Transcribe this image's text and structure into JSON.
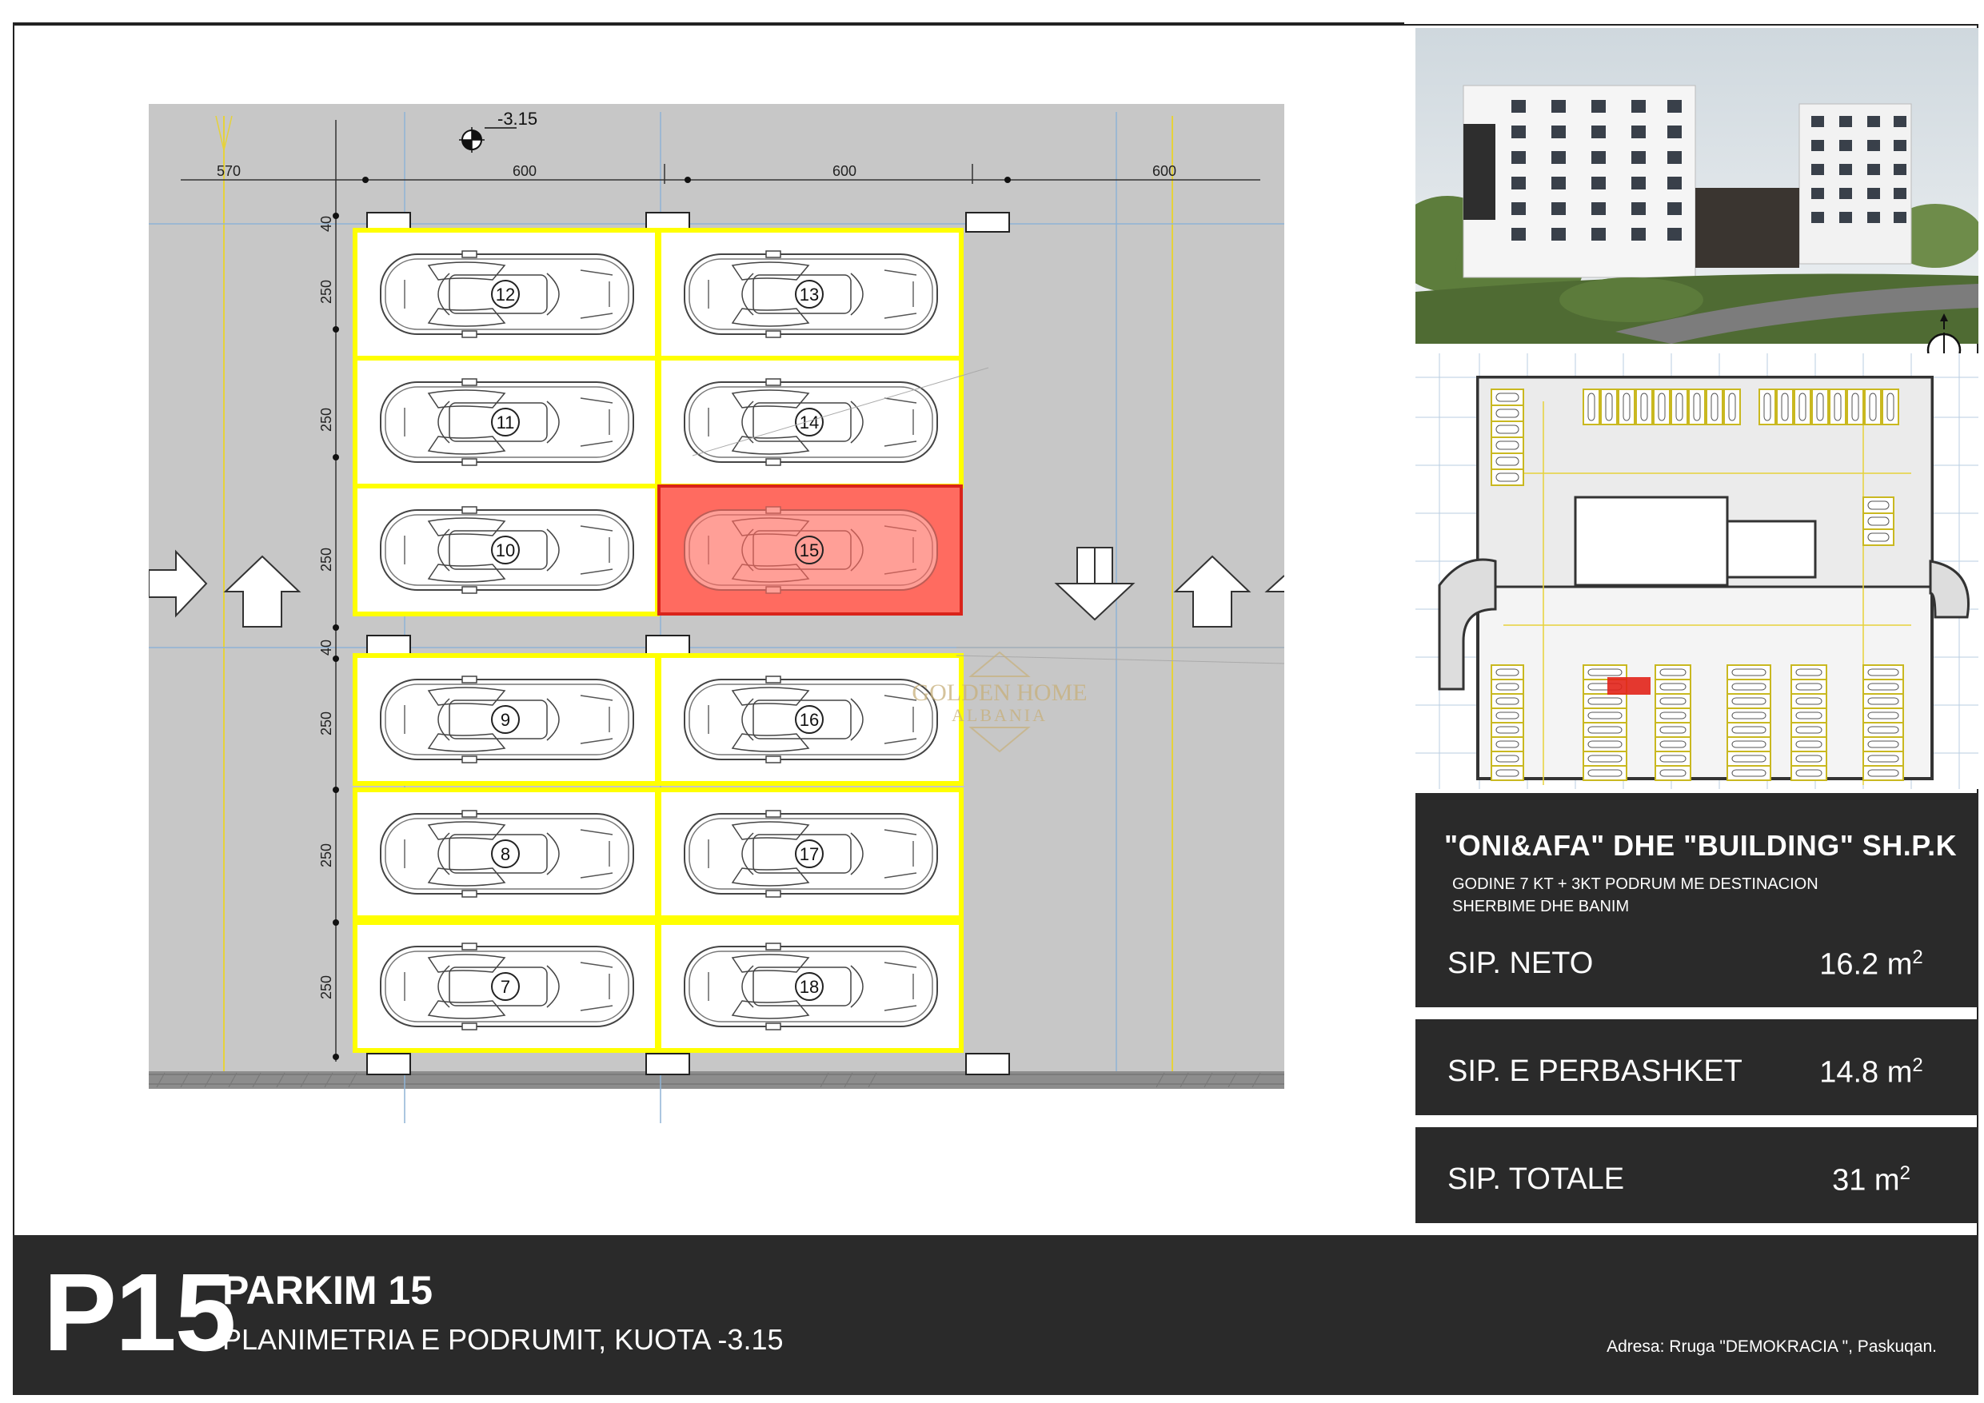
{
  "plan": {
    "level_marker": "-3.15",
    "dimensions_top": [
      "570",
      "600",
      "600",
      "600"
    ],
    "row_dimension": "250",
    "gap_dimension": "40",
    "spots_left": [
      "12",
      "11",
      "10",
      "9",
      "8",
      "7"
    ],
    "spots_right": [
      "13",
      "14",
      "15",
      "16",
      "17",
      "18"
    ],
    "highlighted_spot": "15",
    "highlight_color": "#ff6b60",
    "bay_outline_color": "#ffff00"
  },
  "watermark": {
    "line1": "GOLDEN HOME",
    "line2": "ALBANIA"
  },
  "info": {
    "company": "\"ONI&AFA\" DHE \"BUILDING\" SH.P.K",
    "description": "GODINE 7 KT + 3KT PODRUM ME DESTINACION SHERBIME DHE BANIM"
  },
  "areas": [
    {
      "label": "SIP. NETO",
      "value": "16.2 m"
    },
    {
      "label": "SIP. E PERBASHKET",
      "value": "14.8 m"
    },
    {
      "label": "SIP. TOTALE",
      "value": "31 m"
    }
  ],
  "area_unit_exponent": "2",
  "footer": {
    "code": "P15",
    "title": "PARKIM 15",
    "subtitle": "PLANIMETRIA E PODRUMIT, KUOTA -3.15",
    "address": "Adresa: Rruga \"DEMOKRACIA \", Paskuqan."
  },
  "icons": [
    "north-arrow-icon",
    "level-marker-icon",
    "car-icon",
    "up-arrow-icon",
    "down-arrow-icon",
    "right-arrow-icon"
  ]
}
